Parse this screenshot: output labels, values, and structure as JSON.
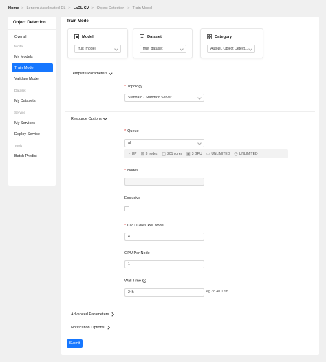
{
  "breadcrumb": {
    "home": "Home",
    "sep": ">",
    "app": "Lenovo Accelerated DL",
    "project": "LaDL CV",
    "task": "Object Detection",
    "page": "Train Model"
  },
  "sidebar": {
    "title": "Object Detection",
    "overview": "Overall",
    "sections": {
      "model": "Model",
      "dataset": "Dataset",
      "service": "Service",
      "tools": "Tools"
    },
    "items": {
      "my_models": "My Models",
      "train_model": "Train Model",
      "validate_model": "Validate Model",
      "my_datasets": "My Datasets",
      "my_services": "My Services",
      "deploy_service": "Deploy Service",
      "batch_predict": "Batch Predict"
    }
  },
  "main": {
    "title": "Train Model",
    "cards": {
      "model": {
        "label": "Model",
        "value": "fruit_model",
        "icon": "model-icon"
      },
      "dataset": {
        "label": "Dataset",
        "value": "fruit_dataset",
        "icon": "dataset-icon"
      },
      "category": {
        "label": "Category",
        "value": "AutoDL Object Detect...",
        "icon": "category-icon"
      }
    },
    "template": {
      "title": "Template Parameters",
      "topology_label": "Topology",
      "topology_value": "Standard - Standard Server"
    },
    "resource": {
      "title": "Resource Options",
      "queue_label": "Queue",
      "queue_value": "all",
      "queue_stats": {
        "status": "UP",
        "nodes": "3 nodes",
        "cores": "201 cores",
        "gpu": "3 GPU",
        "limit1": "UNLIMITED",
        "limit2": "UNLIMITED"
      },
      "nodes_label": "Nodes",
      "nodes_value": "1",
      "exclusive_label": "Exclusive",
      "cpu_label": "CPU Cores Per Node",
      "cpu_value": "4",
      "gpu_label": "GPU Per Node",
      "gpu_value": "1",
      "walltime_label": "Wall Time",
      "walltime_value": "24h",
      "walltime_hint": "eg.3d 4h 12m"
    },
    "advanced": "Advanced Parameters",
    "notification": "Notification Options",
    "submit": "Submit"
  },
  "colors": {
    "accent": "#1677ff",
    "required": "#e53935"
  }
}
